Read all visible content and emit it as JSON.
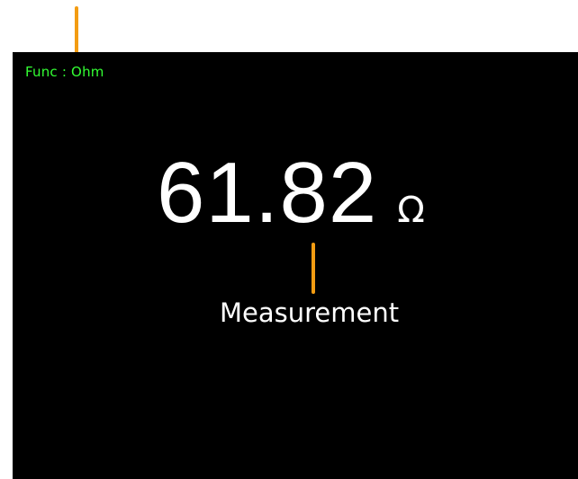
{
  "display": {
    "background": "#000000",
    "function_label": "Func : Ohm",
    "function_color": "#33ff33",
    "measurement_value": "61.82",
    "measurement_unit": "Ω",
    "measurement_color": "#ffffff"
  },
  "annotations": {
    "callout_color": "#f39c12",
    "measurement_label": "Measurement",
    "label_color": "#ffffff"
  }
}
